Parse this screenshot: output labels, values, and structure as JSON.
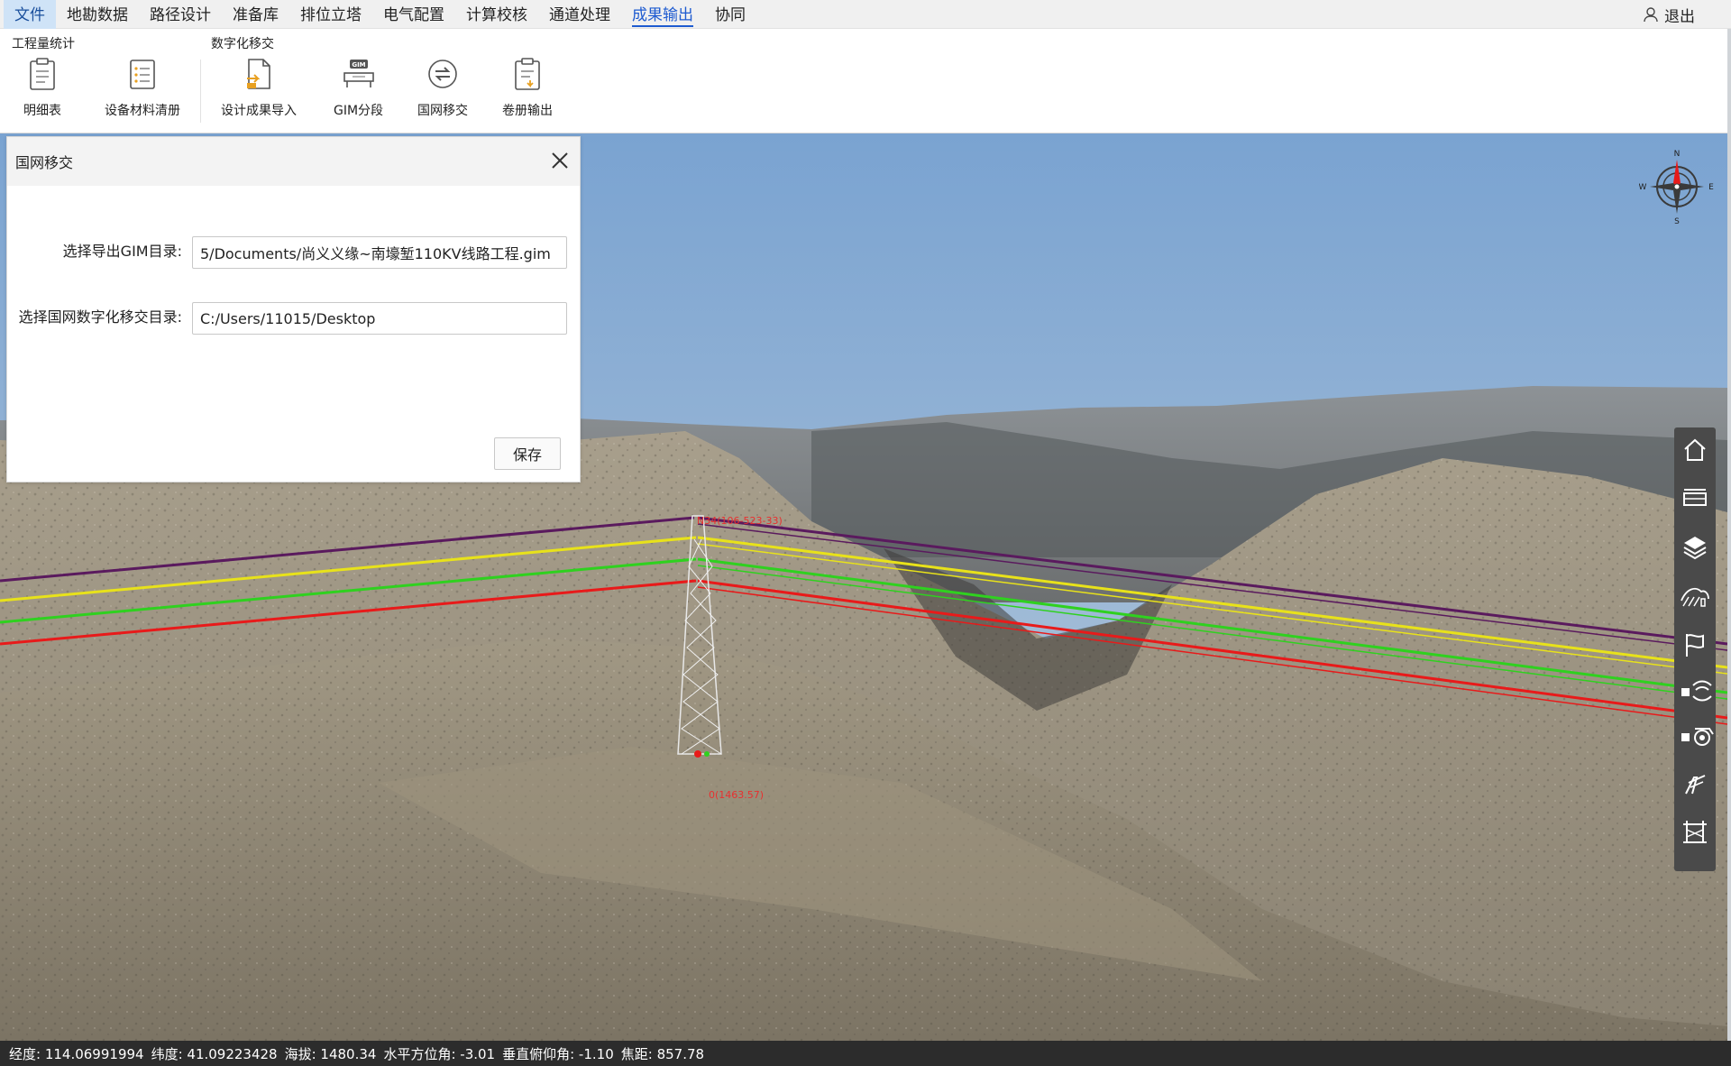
{
  "menu": {
    "items": [
      "文件",
      "地勘数据",
      "路径设计",
      "准备库",
      "排位立塔",
      "电气配置",
      "计算校核",
      "通道处理",
      "成果输出",
      "协同"
    ],
    "active": "文件",
    "selected": "成果输出",
    "logout_label": "退出"
  },
  "ribbon": {
    "group1_label": "工程量统计",
    "group2_label": "数字化移交",
    "buttons": [
      "明细表",
      "设备材料清册",
      "设计成果导入",
      "GIM分段",
      "国网移交",
      "卷册输出"
    ],
    "gim_badge": "GIM"
  },
  "dialog": {
    "title": "国网移交",
    "gim_dir_label": "选择导出GIM目录:",
    "gim_dir_value": "5/Documents/尚义义缘~南壕堑110KV线路工程.gim",
    "handover_dir_label": "选择国网数字化移交目录:",
    "handover_dir_value": "C:/Users/11015/Desktop",
    "save_label": "保存"
  },
  "scene": {
    "tower_label": "N34(106-523-33)",
    "ground_label": "0(1463.57)",
    "wire_colors": [
      "#5a1a5e",
      "#e8e21a",
      "#2fd11f",
      "#e81a1a"
    ],
    "sky_top": "#7aa3d1",
    "sky_bottom": "#c8d3da"
  },
  "compass": {
    "n": "N",
    "s": "S",
    "e": "E",
    "w": "W"
  },
  "side_toolbar": [
    "home-icon",
    "ruler-icon",
    "layers-icon",
    "terrain-icon",
    "flag-icon",
    "signal-icon",
    "camera-icon",
    "tower-tool-icon",
    "gantry-icon"
  ],
  "status": {
    "lon": "经度: 114.06991994",
    "lat": "纬度: 41.09223428",
    "alt": "海拔: 1480.34",
    "heading": "水平方位角: -3.01",
    "pitch": "垂直俯仰角: -1.10",
    "focal": "焦距: 857.78"
  }
}
